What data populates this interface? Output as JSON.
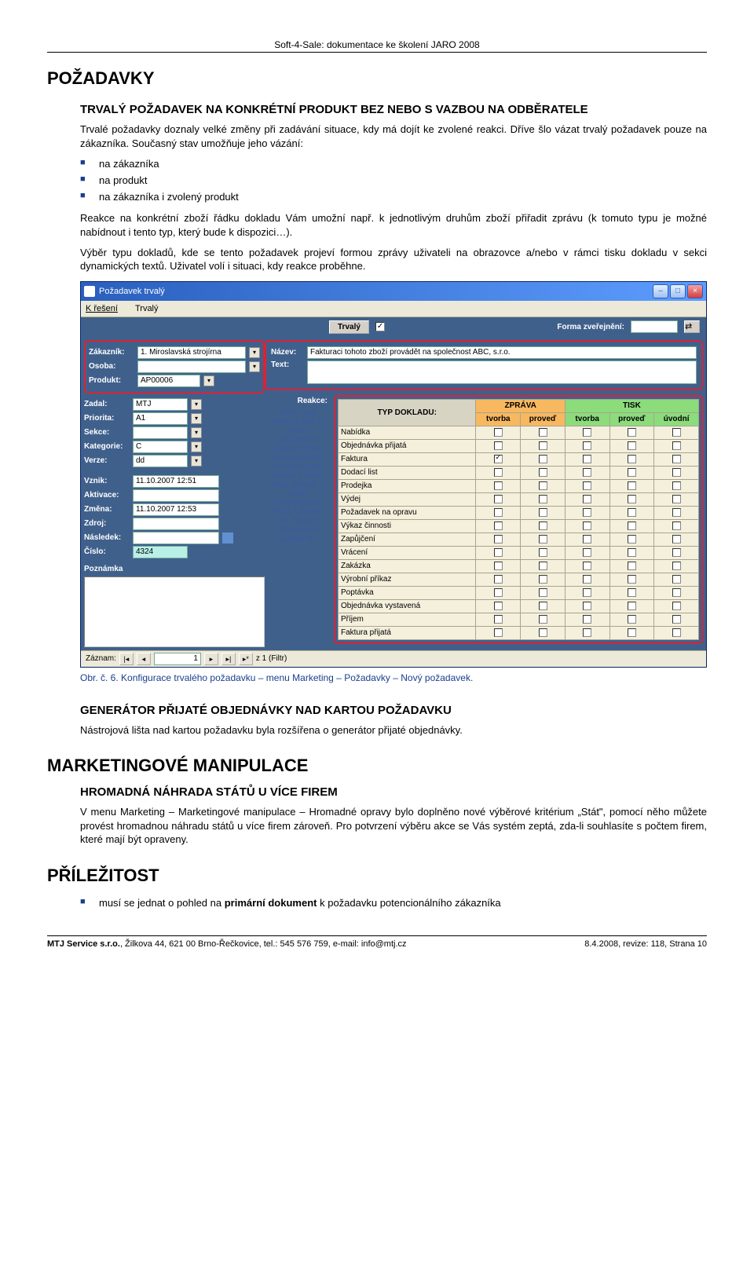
{
  "header": "Soft-4-Sale: dokumentace ke školení JARO 2008",
  "h1": "POŽADAVKY",
  "s1": {
    "h3": "TRVALÝ POŽADAVEK NA KONKRÉTNÍ PRODUKT BEZ NEBO S VAZBOU NA ODBĚRATELE",
    "p1": "Trvalé požadavky doznaly velké změny při zadávání situace, kdy má dojít ke zvolené reakci. Dříve šlo vázat trvalý požadavek pouze na zákazníka. Současný stav umožňuje jeho vázání:",
    "bullets": [
      "na zákazníka",
      "na produkt",
      "na zákazníka i zvolený produkt"
    ],
    "p2": "Reakce na konkrétní zboží řádku dokladu Vám umožní např. k jednotlivým druhům zboží přiřadit zprávu (k tomuto typu je možné nabídnout i tento typ, který bude k dispozici…).",
    "p3": "Výběr typu dokladů, kde se tento požadavek projeví formou zprávy uživateli na obrazovce a/nebo v rámci tisku dokladu v sekci dynamických textů. Uživatel volí i situaci, kdy reakce proběhne."
  },
  "win": {
    "title": "Požadavek trvalý",
    "menu": [
      "K řešení",
      "Trvalý"
    ],
    "top": {
      "btn": "Trvalý",
      "label": "Forma zveřejnění:"
    },
    "left": {
      "zakaznik_lbl": "Zákazník:",
      "zakaznik": "1. Miroslavská strojírna",
      "osoba_lbl": "Osoba:",
      "osoba": "",
      "produkt_lbl": "Produkt:",
      "produkt": "AP00006",
      "zadal_lbl": "Zadal:",
      "zadal": "MTJ",
      "priorita_lbl": "Priorita:",
      "priorita": "A1",
      "sekce_lbl": "Sekce:",
      "kategorie_lbl": "Kategorie:",
      "kategorie": "C",
      "verze_lbl": "Verze:",
      "verze": "dd",
      "vznik_lbl": "Vznik:",
      "vznik": "11.10.2007 12:51",
      "aktivace_lbl": "Aktivace:",
      "zmena_lbl": "Změna:",
      "zmena": "11.10.2007 12:53",
      "zdroj_lbl": "Zdroj:",
      "nasledek_lbl": "Následek:",
      "cislo_lbl": "Číslo:",
      "cislo": "4324",
      "poznamka_lbl": "Poznámka"
    },
    "right": {
      "nazev_lbl": "Název:",
      "nazev": "Fakturaci tohoto zboží provádět na společnost ABC, s.r.o.",
      "text_lbl": "Text:",
      "reakce_lbl": "Reakce:",
      "reakce_help": "Výběr typu dokladů, kde se tento požadavek projeví formou zprávy uživateli na obrazovce a/nebo v rámci tisku dokladu v sekci dynamických textů. Uživatel volí i situaci, kdy reakce proběhne."
    },
    "grid": {
      "h_typ": "TYP DOKLADU:",
      "h_zprava": "ZPRÁVA",
      "h_tisk": "TISK",
      "sub_z": [
        "tvorba",
        "proveď"
      ],
      "sub_t": [
        "tvorba",
        "proveď",
        "úvodní"
      ],
      "rows": [
        {
          "name": "Nabídka",
          "z": [
            0,
            0
          ],
          "t": [
            0,
            0,
            0
          ]
        },
        {
          "name": "Objednávka přijatá",
          "z": [
            0,
            0
          ],
          "t": [
            0,
            0,
            0
          ]
        },
        {
          "name": "Faktura",
          "z": [
            1,
            0
          ],
          "t": [
            0,
            0,
            0
          ]
        },
        {
          "name": "Dodací list",
          "z": [
            0,
            0
          ],
          "t": [
            0,
            0,
            0
          ]
        },
        {
          "name": "Prodejka",
          "z": [
            0,
            0
          ],
          "t": [
            0,
            0,
            0
          ]
        },
        {
          "name": "Výdej",
          "z": [
            0,
            0
          ],
          "t": [
            0,
            0,
            0
          ]
        },
        {
          "name": "Požadavek na opravu",
          "z": [
            0,
            0
          ],
          "t": [
            0,
            0,
            0
          ]
        },
        {
          "name": "Výkaz činnosti",
          "z": [
            0,
            0
          ],
          "t": [
            0,
            0,
            0
          ]
        },
        {
          "name": "Zapůjčení",
          "z": [
            0,
            0
          ],
          "t": [
            0,
            0,
            0
          ]
        },
        {
          "name": "Vrácení",
          "z": [
            0,
            0
          ],
          "t": [
            0,
            0,
            0
          ]
        },
        {
          "name": "Zakázka",
          "z": [
            0,
            0
          ],
          "t": [
            0,
            0,
            0
          ]
        },
        {
          "name": "Výrobní příkaz",
          "z": [
            0,
            0
          ],
          "t": [
            0,
            0,
            0
          ]
        },
        {
          "name": "Poptávka",
          "z": [
            0,
            0
          ],
          "t": [
            0,
            0,
            0
          ]
        },
        {
          "name": "Objednávka vystavená",
          "z": [
            0,
            0
          ],
          "t": [
            0,
            0,
            0
          ]
        },
        {
          "name": "Příjem",
          "z": [
            0,
            0
          ],
          "t": [
            0,
            0,
            0
          ]
        },
        {
          "name": "Faktura přijatá",
          "z": [
            0,
            0
          ],
          "t": [
            0,
            0,
            0
          ]
        }
      ]
    },
    "status": {
      "zaznam": "Záznam:",
      "pos": "1",
      "filter": "z  1 (Filtr)"
    }
  },
  "caption": "Obr. č. 6. Konfigurace trvalého požadavku – menu Marketing – Požadavky – Nový požadavek.",
  "s2": {
    "h3": "GENERÁTOR PŘIJATÉ OBJEDNÁVKY NAD KARTOU POŽADAVKU",
    "p": "Nástrojová lišta nad kartou požadavku byla rozšířena o generátor přijaté objednávky."
  },
  "h2a": "MARKETINGOVÉ MANIPULACE",
  "s3": {
    "h3": "HROMADNÁ NÁHRADA STÁTŮ U VÍCE FIREM",
    "p": "V menu Marketing – Marketingové manipulace – Hromadné opravy bylo doplněno nové výběrové kritérium „Stát\", pomocí něho můžete provést hromadnou náhradu států u více firem zároveň. Pro potvrzení výběru akce se Vás systém zeptá, zda-li souhlasíte s počtem firem, které mají být opraveny."
  },
  "h2b": "PŘÍLEŽITOST",
  "s4": {
    "b1a": "musí se jednat o pohled na ",
    "b1b": "primární dokument",
    "b1c": " k požadavku potencionálního zákazníka"
  },
  "footer": {
    "left": "MTJ Service s.r.o., Žilkova 44, 621 00 Brno-Řečkovice, tel.: 545 576 759, e-mail: info@mtj.cz",
    "right": "8.4.2008, revize: 118, Strana 10"
  }
}
